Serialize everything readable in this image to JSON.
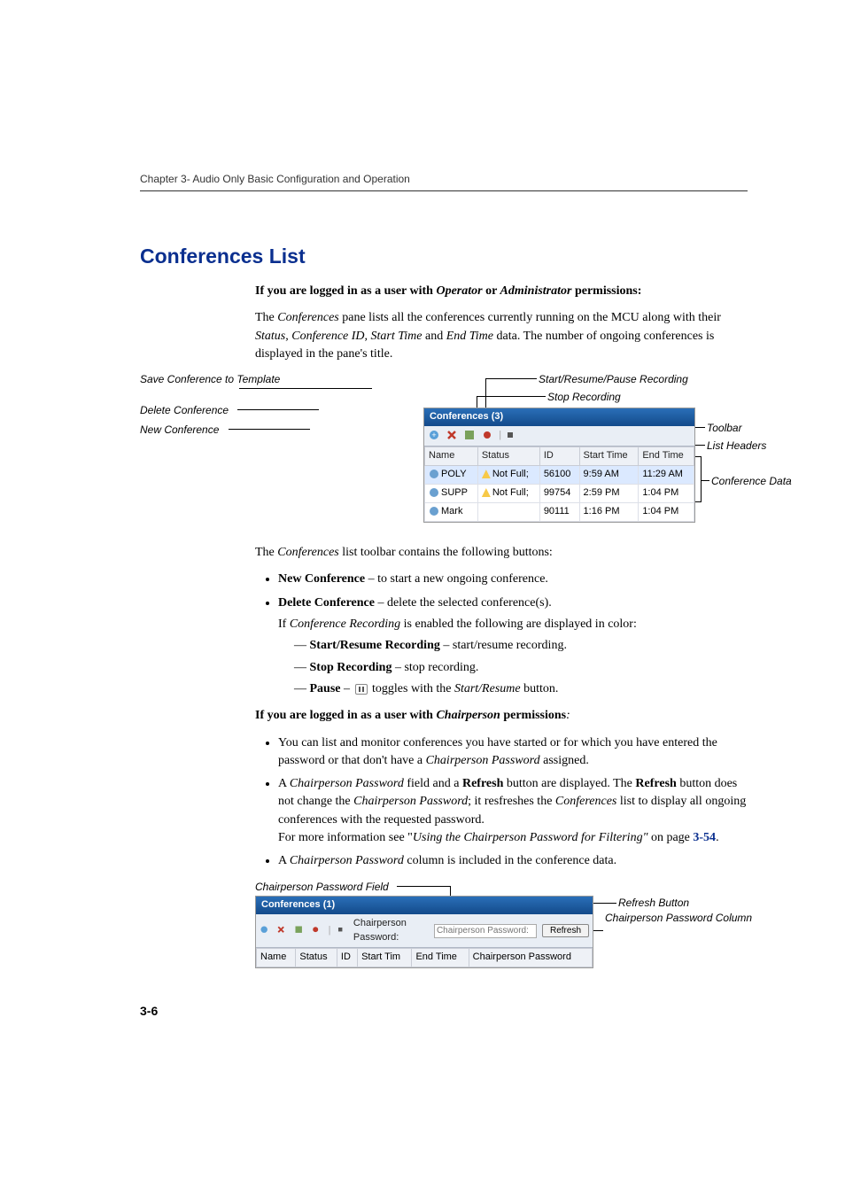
{
  "chapter": "Chapter 3- Audio Only Basic Configuration and Operation",
  "section_title": "Conferences List",
  "intro_bold": "If you are logged in as a user with ",
  "intro_op": "Operator",
  "intro_or": " or ",
  "intro_admin": "Administrator",
  "intro_perm": " permissions:",
  "intro_para": "The Conferences pane lists all the conferences currently running on the MCU along with their Status, Conference ID, Start Time and End Time data. The number of ongoing conferences is displayed in the pane's title.",
  "callouts": {
    "save": "Save Conference to Template",
    "delete": "Delete Conference",
    "newc": "New Conference",
    "startresume": "Start/Resume/Pause Recording",
    "stoprec": "Stop Recording",
    "toolbar": "Toolbar",
    "listheaders": "List Headers",
    "confdata": "Conference Data"
  },
  "panel": {
    "title": "Conferences (3)",
    "headers": [
      "Name",
      "Status",
      "ID",
      "Start Time",
      "End Time"
    ],
    "rows": [
      {
        "name": "POLY",
        "status": "Not Full;",
        "id": "56100",
        "start": "9:59 AM",
        "end": "11:29 AM",
        "warn": true,
        "sel": true
      },
      {
        "name": "SUPP",
        "status": "Not Full;",
        "id": "99754",
        "start": "2:59 PM",
        "end": "1:04 PM",
        "warn": true,
        "sel": false
      },
      {
        "name": "Mark",
        "status": "",
        "id": "90111",
        "start": "1:16 PM",
        "end": "1:04 PM",
        "warn": false,
        "sel": false
      }
    ]
  },
  "toolbar_sentence": "The Conferences list toolbar contains the following buttons:",
  "b1": {
    "title": "New Conference",
    "desc": " – to start a new ongoing conference."
  },
  "b2": {
    "title": "Delete Conference",
    "desc": " – delete the selected conference(s)."
  },
  "b2_sub": "If Conference Recording is enabled the following are displayed in color:",
  "d1": {
    "title": "Start/Resume Recording",
    "desc": " – start/resume recording."
  },
  "d2": {
    "title": "Stop Recording",
    "desc": " – stop recording."
  },
  "d3": {
    "title": "Pause",
    "desc1": " – ",
    "desc2": " toggles with the ",
    "italic": "Start/Resume",
    "desc3": " button."
  },
  "chair_heading_pre": "If you are logged in as a user with ",
  "chair_heading_i": "Chairperson",
  "chair_heading_post": " permissions",
  "chair_colon": ":",
  "chair_b1": "You can list and monitor conferences you have started or for which you have entered the password or that don't have a Chairperson Password assigned.",
  "chair_b2_pre": "A ",
  "chair_b2_i1": "Chairperson Password",
  "chair_b2_mid1": " field and a ",
  "chair_b2_b1": "Refresh",
  "chair_b2_mid2": " button are displayed. The ",
  "chair_b2_b2": "Refresh",
  "chair_b2_mid3": " button does not change the ",
  "chair_b2_i2": "Chairperson Password",
  "chair_b2_mid4": "; it resfreshes the ",
  "chair_b2_i3": "Conferences",
  "chair_b2_mid5": " list to display all ongoing conferences with the requested password.",
  "chair_b2_more": "For more information see \"",
  "chair_b2_more_i": "Using the Chairperson Password for Filtering\"",
  "chair_b2_more2": " on page ",
  "chair_b2_link": "3-54",
  "chair_b2_dot": ".",
  "chair_b3_pre": "A ",
  "chair_b3_i": "Chairperson Password",
  "chair_b3_post": " column is included in the conference data.",
  "fig2": {
    "caption": "Chairperson Password Field",
    "panel_title": "Conferences (1)",
    "field_label": "Chairperson Password:",
    "refresh": "Refresh",
    "headers": [
      "Name",
      "Status",
      "ID",
      "Start Tim",
      "End Time",
      "Chairperson Password"
    ]
  },
  "callouts2": {
    "refreshbtn": "Refresh Button",
    "cpcol": "Chairperson Password Column"
  },
  "page_number": "3-6"
}
